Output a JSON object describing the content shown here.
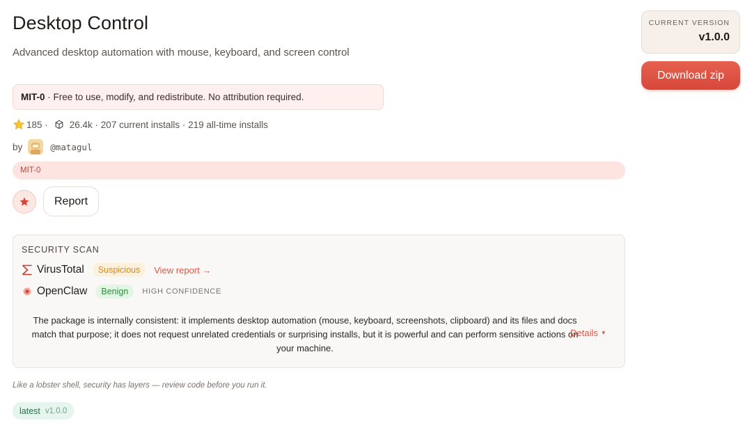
{
  "page": {
    "title": "Desktop Control",
    "subtitle": "Advanced desktop automation with mouse, keyboard, and screen control"
  },
  "license_notice": {
    "name": "MIT-0",
    "text": " · Free to use, modify, and redistribute. No attribution required."
  },
  "stats": {
    "stars": "185 ·",
    "installs": "26.4k · 207 current installs · 219 all-time installs"
  },
  "author": {
    "by_label": "by",
    "handle": "@matagul"
  },
  "tag": "MIT-0",
  "actions": {
    "report_label": "Report"
  },
  "security_scan": {
    "heading": "SECURITY SCAN",
    "virustotal": {
      "name": "VirusTotal",
      "status": "Suspicious",
      "link": "View report →"
    },
    "openclaw": {
      "name": "OpenClaw",
      "status": "Benign",
      "confidence": "HIGH CONFIDENCE"
    },
    "summary": "The package is internally consistent: it implements desktop automation (mouse, keyboard, screenshots, clipboard) and its files and docs match that purpose; it does not request unrelated credentials or surprising installs, but it is powerful and can perform sensitive actions on your machine.",
    "details_label": "Details"
  },
  "footnote": "Like a lobster shell, security has layers — review code before you run it.",
  "latest_tag": {
    "label": "latest",
    "version": "v1.0.0"
  },
  "sidebar": {
    "version_label": "CURRENT VERSION",
    "version_value": "v1.0.0",
    "download_label": "Download zip"
  },
  "colors": {
    "accent": "#d9584a",
    "suspicious": "#d68a1a",
    "benign": "#2e8b3d"
  }
}
